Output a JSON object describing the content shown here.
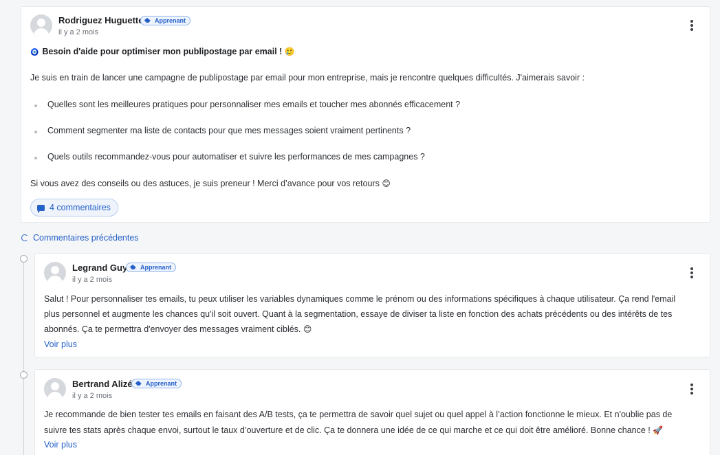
{
  "post": {
    "author": "Rodriguez Huguette",
    "badge": "Apprenant",
    "time": "il y a 2 mois",
    "title_emoji": "🧿",
    "title": "Besoin d'aide pour optimiser mon publipostage par email !",
    "title_emoji_end": "🥲",
    "intro": "Je suis en train de lancer une campagne de publipostage par email pour mon entreprise, mais je rencontre quelques difficultés. J'aimerais savoir :",
    "bullets": [
      "Quelles sont les meilleures pratiques pour personnaliser mes emails et toucher mes abonnés efficacement ?",
      "Comment segmenter ma liste de contacts pour que mes messages soient vraiment pertinents ?",
      "Quels outils recommandez-vous pour automatiser et suivre les performances de mes campagnes ?"
    ],
    "closing": "Si vous avez des conseils ou des astuces, je suis preneur ! Merci d’avance pour vos retours",
    "closing_emoji": "😊",
    "comments_label": "4 commentaires"
  },
  "previous_comments_label": "Commentaires précédentes",
  "comments": [
    {
      "author": "Legrand Guy",
      "badge": "Apprenant",
      "time": "il y a 2 mois",
      "lines": [
        "Salut ! Pour personnaliser tes emails, tu peux utiliser les variables dynamiques comme le prénom ou des informations spécifiques à chaque utilisateur. Ça rend l'email",
        "plus personnel et augmente les chances qu'il soit ouvert. Quant à la segmentation, essaye de diviser ta liste en fonction des achats précédents ou des intérêts de tes",
        "abonnés. Ça te permettra d'envoyer des messages vraiment ciblés."
      ],
      "end_emoji": "😊",
      "see_more": "Voir plus"
    },
    {
      "author": "Bertrand Alizé",
      "badge": "Apprenant",
      "time": "il y a 2 mois",
      "lines": [
        "Je recommande de bien tester tes emails en faisant des A/B tests, ça te permettra de savoir quel sujet ou quel appel à l’action fonctionne le mieux. Et n'oublie pas de",
        "suivre tes stats après chaque envoi, surtout le taux d’ouverture et de clic. Ça te donnera une idée de ce qui marche et ce qui doit être amélioré. Bonne chance !"
      ],
      "end_emoji": "🚀",
      "see_more": "Voir plus"
    }
  ],
  "icons": {
    "avatar": "user-avatar-icon",
    "menu": "more-vertical-icon",
    "badge": "graduation-cap-icon",
    "comments": "chat-bubble-icon",
    "previous": "refresh-icon"
  },
  "colors": {
    "accent": "#2561c6",
    "badge_bg": "#eef4fd",
    "card_border": "#e6e8eb",
    "page_bg": "#f5f6f8"
  }
}
